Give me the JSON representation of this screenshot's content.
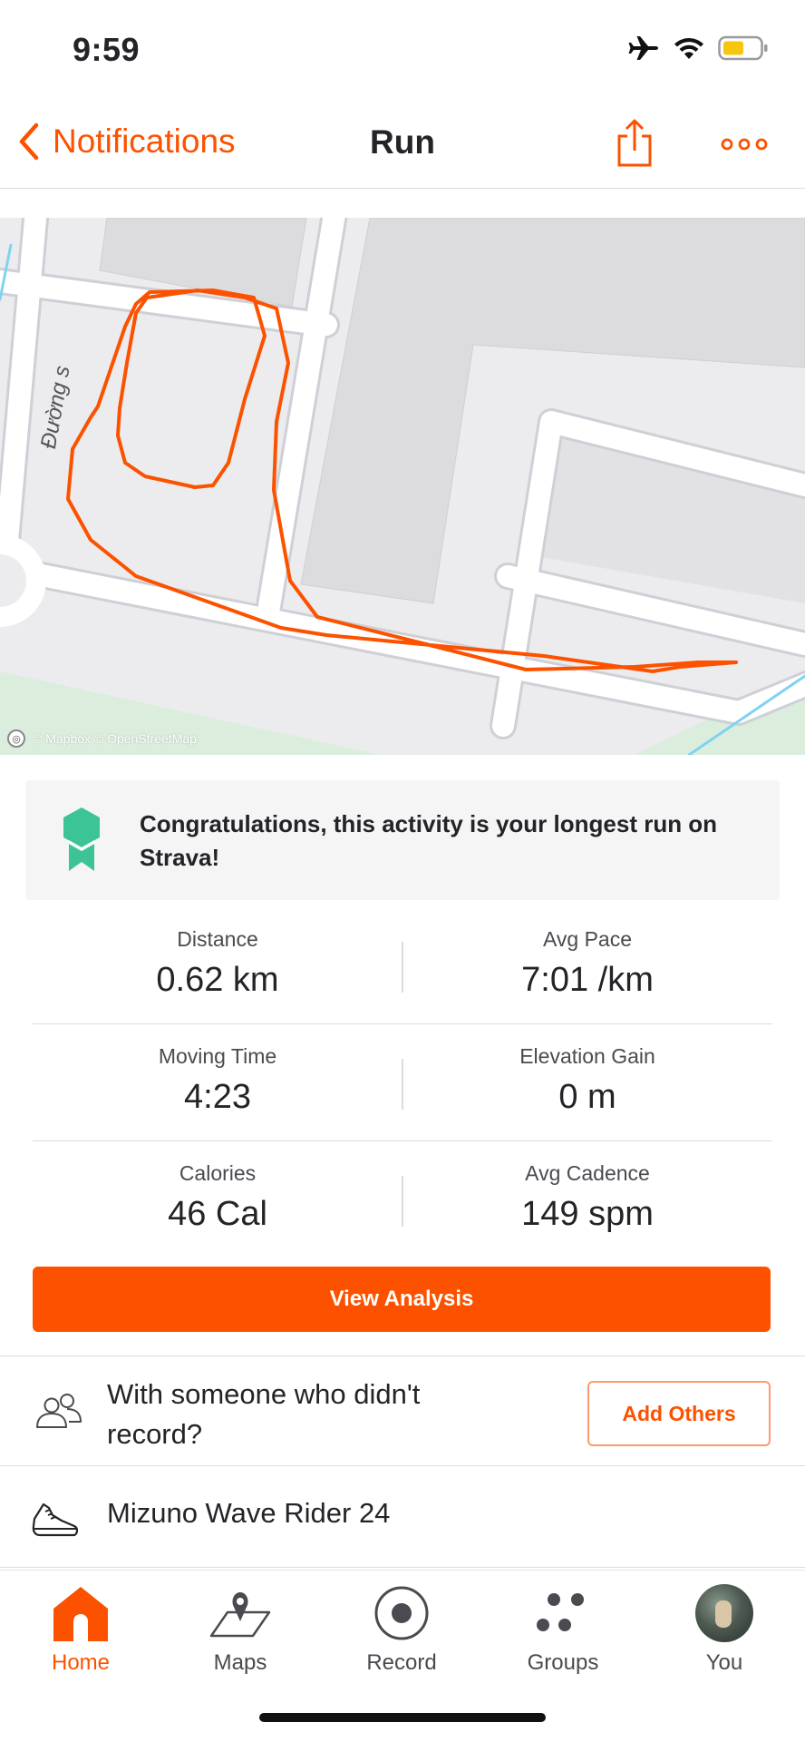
{
  "status_bar": {
    "time": "9:59"
  },
  "nav": {
    "back_label": "Notifications",
    "title": "Run"
  },
  "map": {
    "road_label": "Đường s",
    "attribution": "© Mapbox © OpenStreetMap",
    "route_color": "#fc5200"
  },
  "achievement": {
    "text": "Congratulations, this activity is your longest run on Strava!",
    "badge_color": "#3cc496"
  },
  "stats": [
    {
      "left_label": "Distance",
      "left_value": "0.62 km",
      "right_label": "Avg Pace",
      "right_value": "7:01 /km"
    },
    {
      "left_label": "Moving Time",
      "left_value": "4:23",
      "right_label": "Elevation Gain",
      "right_value": "0 m"
    },
    {
      "left_label": "Calories",
      "left_value": "46 Cal",
      "right_label": "Avg Cadence",
      "right_value": "149 spm"
    }
  ],
  "analysis_button": "View Analysis",
  "others": {
    "text": "With someone who didn't record?",
    "button": "Add Others"
  },
  "gear": {
    "text": "Mizuno Wave Rider 24"
  },
  "tabs": [
    {
      "label": "Home",
      "icon": "home-icon",
      "active": true
    },
    {
      "label": "Maps",
      "icon": "maps-icon",
      "active": false
    },
    {
      "label": "Record",
      "icon": "record-icon",
      "active": false
    },
    {
      "label": "Groups",
      "icon": "groups-icon",
      "active": false
    },
    {
      "label": "You",
      "icon": "avatar",
      "active": false
    }
  ],
  "colors": {
    "accent": "#fc5200",
    "text": "#242428",
    "divider": "#dcdcde"
  }
}
